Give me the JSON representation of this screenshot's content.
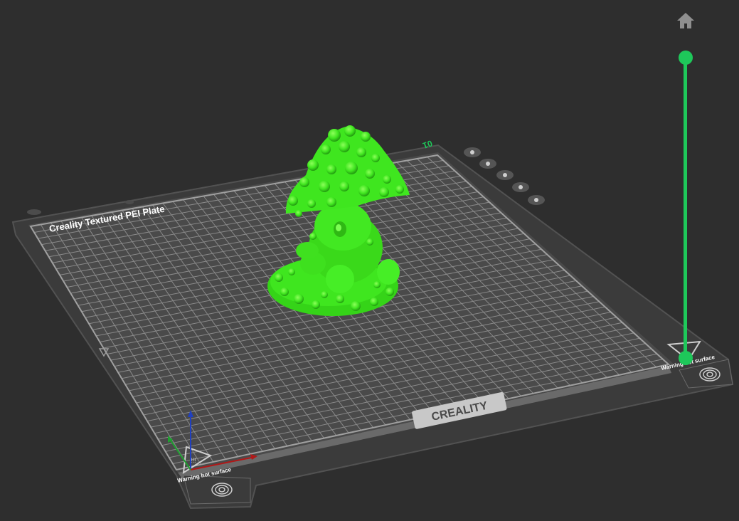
{
  "plate": {
    "name": "Creality Textured PEI Plate",
    "number": "01",
    "brand": "CREALITY",
    "warning_left": "Warning hot surface",
    "warning_right": "Warning hot surface"
  },
  "plate_toolbar": {
    "icons": [
      "close-icon",
      "arrange-icon",
      "orient-icon",
      "lock-icon",
      "settings-icon"
    ]
  },
  "toolbar": {
    "home_icon": "home-icon"
  },
  "layer_slider": {
    "top_layer_fraction": 1.0,
    "bottom_layer_fraction": 0.0
  },
  "colors": {
    "background": "#2e2e2e",
    "model": "#39e01b",
    "accent": "#1ec85a",
    "plate": "#3a3a3a",
    "grid": "#8a8a8a"
  }
}
